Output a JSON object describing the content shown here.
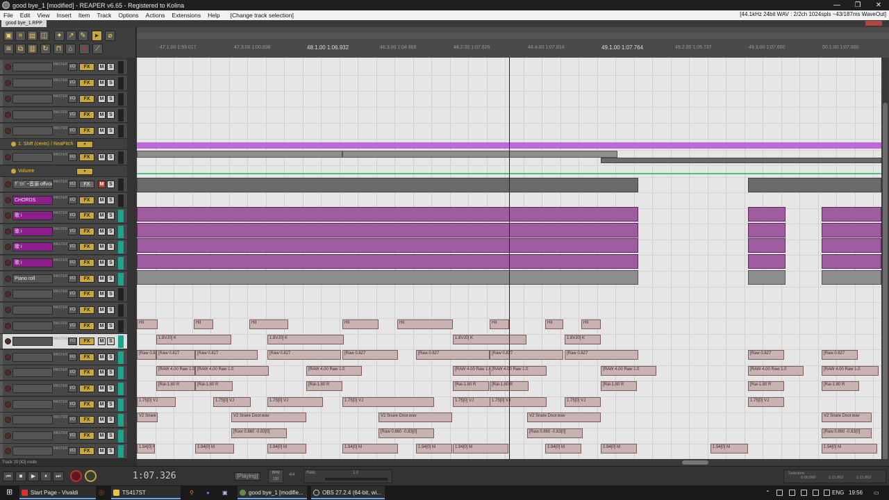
{
  "window": {
    "title": "good bye_1 [modified] - REAPER v6.65 - Registered to Kolina",
    "controls": [
      "—",
      "❐",
      "✕"
    ]
  },
  "menubar": {
    "items": [
      "File",
      "Edit",
      "View",
      "Insert",
      "Item",
      "Track",
      "Options",
      "Actions",
      "Extensions",
      "Help"
    ],
    "last_action": "[Change track selection]",
    "audio_status": "[44.1kHz 24bit WAV : 2/2ch 1024spls ~43/187ms WaveOut]"
  },
  "project_tab": {
    "label": "good bye_1.RPP"
  },
  "ruler": {
    "marks": [
      "47.1.00\n1:59.017",
      "47.3.00\n1:00.838",
      "48.1.00\n1:06.932",
      "48.3.00\n1:04.966",
      "48.2.00\n1:07.626",
      "48.4.00\n1:07.814",
      "49.1.00\n1:07.764",
      "49.2.00\n1:05.737",
      "49.3.00\n1:07.600",
      "50.1.00\n1:07.600"
    ]
  },
  "tracks": {
    "master_label": "MASTER",
    "io_label": "I/O",
    "fx_label": "FX",
    "mute_label": "M",
    "solo_label": "S",
    "rows": [
      {
        "name": ""
      },
      {
        "name": ""
      },
      {
        "name": ""
      },
      {
        "name": ""
      },
      {
        "name": ""
      },
      {
        "name": ""
      },
      {
        "name": "ｸﾞﾘﾊﾞｰ音源 offvox"
      },
      {
        "name": "CHORDS"
      },
      {
        "name": "歌 i"
      },
      {
        "name": "歌 i"
      },
      {
        "name": "歌 i"
      },
      {
        "name": "歌 i"
      },
      {
        "name": "Piano roll"
      },
      {
        "name": ""
      },
      {
        "name": ""
      },
      {
        "name": ""
      },
      {
        "name": ""
      },
      {
        "name": ""
      },
      {
        "name": ""
      },
      {
        "name": ""
      },
      {
        "name": ""
      },
      {
        "name": ""
      },
      {
        "name": ""
      },
      {
        "name": ""
      },
      {
        "name": ""
      }
    ]
  },
  "envelopes": {
    "shift": {
      "name": "1: Shift (cents) / ReaPitch",
      "btn": "▾"
    },
    "volume": {
      "name": "Volume",
      "btn": "▾"
    }
  },
  "items": {
    "labels": {
      "hit": "Hit",
      "k": "1.8VJ0] K",
      "raw": "[Raw 0.827",
      "raw2": "[RAW 4.00 Raw 1.0",
      "ra": "[Rai-1.80 R",
      "vj": "1.75[0] VJ",
      "snare": "V2 Snare Door.wav",
      "raw3": "[Raw 0.860 -0.83[0]",
      "m": "1.94[0] M"
    }
  },
  "status_row": "Track 19 [IO] route",
  "transport": {
    "timecode": "1:07.326",
    "play_state": "[Playing]",
    "bpm": "BPM\n120",
    "time_sig": "4/4",
    "rate_label": "Rate:",
    "rate_value": "1.0",
    "selection_label": "Selection:",
    "sel_start": "0:00.000",
    "sel_end": "1:21.862",
    "sel_len": "1:21.862"
  },
  "taskbar": {
    "apps": [
      {
        "label": "Start Page - Vivaldi",
        "color": "#e0312a"
      },
      {
        "label": "TS417ST",
        "color": "#f0c040"
      },
      {
        "label": "good bye_1 [modifie...",
        "color": "#6a8a4a"
      },
      {
        "label": "OBS 27.2.4 (64-bit, wi...",
        "color": "#303030"
      }
    ],
    "language": "ENG",
    "clock": "19:56"
  }
}
